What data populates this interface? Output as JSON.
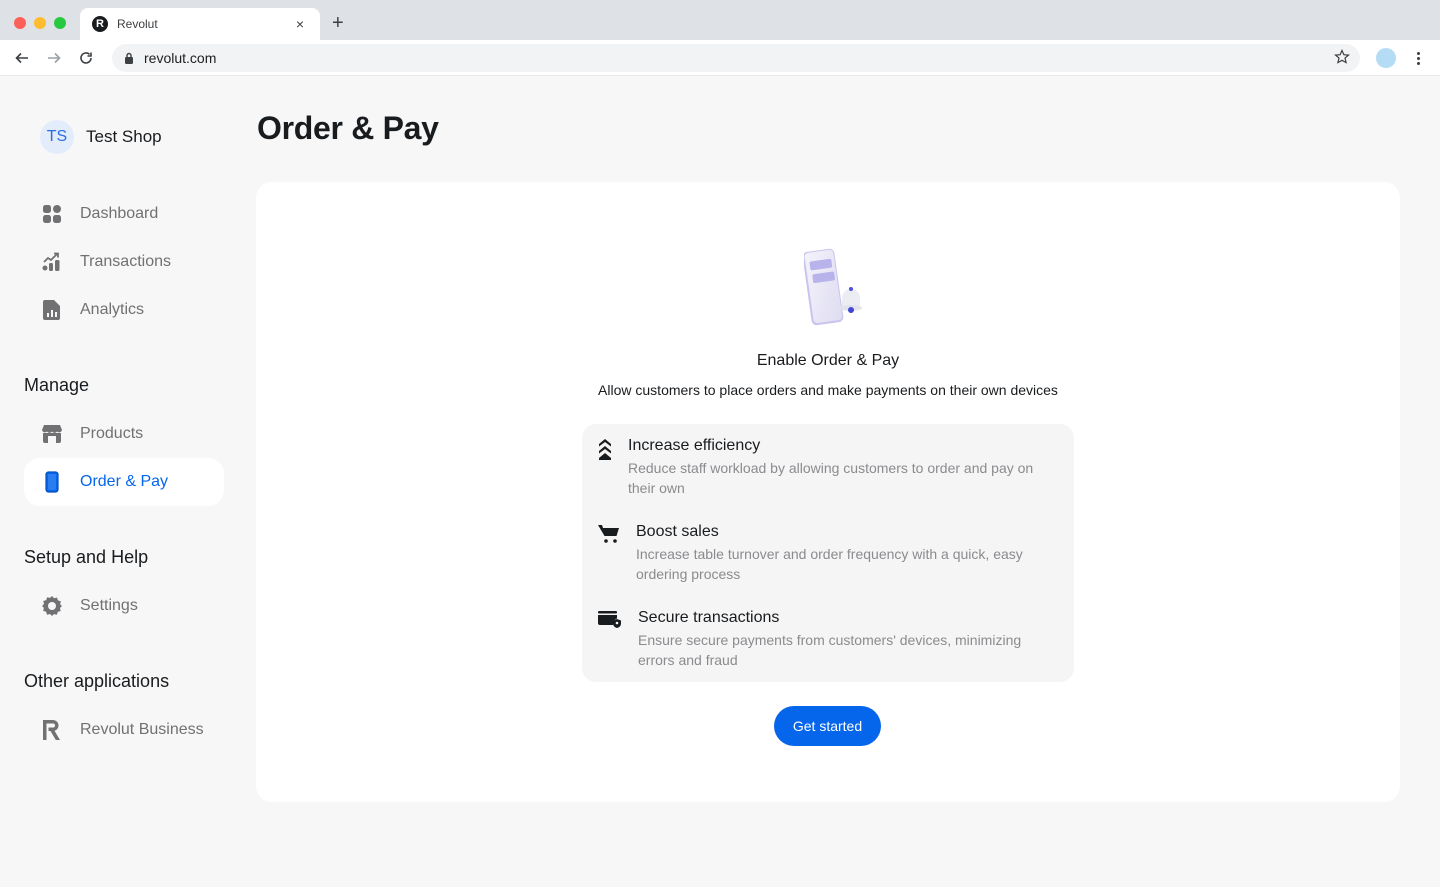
{
  "browser": {
    "tab_title": "Revolut",
    "tab_favicon_letter": "R",
    "url": "revolut.com",
    "new_tab_label": "+",
    "close_tab_label": "×"
  },
  "sidebar": {
    "shop": {
      "initials": "TS",
      "name": "Test Shop"
    },
    "items_main": [
      {
        "label": "Dashboard",
        "icon": "dashboard-icon"
      },
      {
        "label": "Transactions",
        "icon": "transactions-icon"
      },
      {
        "label": "Analytics",
        "icon": "analytics-icon"
      }
    ],
    "manage": {
      "title": "Manage",
      "items": [
        {
          "label": "Products",
          "icon": "store-icon"
        },
        {
          "label": "Order & Pay",
          "icon": "phone-icon",
          "active": true
        }
      ]
    },
    "setup": {
      "title": "Setup and Help",
      "items": [
        {
          "label": "Settings",
          "icon": "gear-icon"
        }
      ]
    },
    "other": {
      "title": "Other applications",
      "items": [
        {
          "label": "Revolut Business",
          "icon": "revolut-logo-icon"
        }
      ]
    }
  },
  "main": {
    "title": "Order & Pay",
    "card": {
      "headline": "Enable Order & Pay",
      "subline": "Allow customers to place orders and make payments on their own devices",
      "features": [
        {
          "title": "Increase efficiency",
          "description": "Reduce staff workload by allowing customers to order and pay on their own",
          "icon": "chevrons-up-icon"
        },
        {
          "title": "Boost sales",
          "description": "Increase table turnover and order frequency with a quick, easy ordering process",
          "icon": "cart-icon"
        },
        {
          "title": "Secure transactions",
          "description": "Ensure secure payments from customers' devices, minimizing errors and fraud",
          "icon": "card-shield-icon"
        }
      ],
      "cta_label": "Get started"
    }
  },
  "colors": {
    "accent": "#0666eb",
    "background": "#f7f7f7",
    "muted_text": "#717173"
  }
}
